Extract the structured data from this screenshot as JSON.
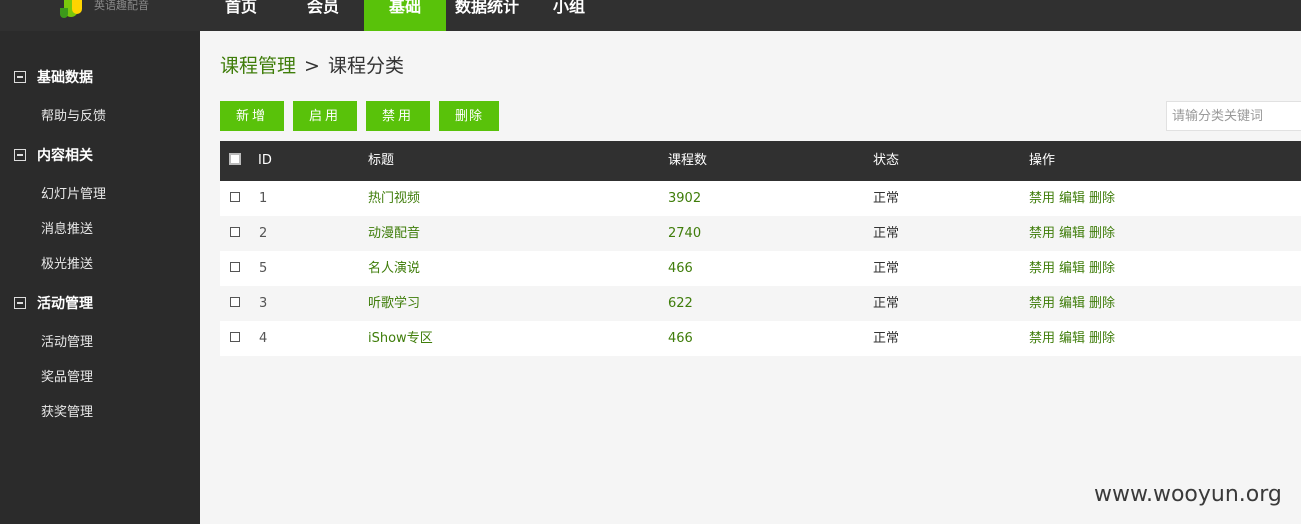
{
  "logo": {
    "text": "英语趣配音"
  },
  "nav": {
    "items": [
      {
        "label": "首页"
      },
      {
        "label": "会员"
      },
      {
        "label": "基础"
      },
      {
        "label": "数据统计"
      },
      {
        "label": "小组"
      }
    ],
    "active_index": 2
  },
  "sidebar": {
    "groups": [
      {
        "label": "基础数据",
        "items": [
          "帮助与反馈"
        ]
      },
      {
        "label": "内容相关",
        "items": [
          "幻灯片管理",
          "消息推送",
          "极光推送"
        ]
      },
      {
        "label": "活动管理",
        "items": [
          "活动管理",
          "奖品管理",
          "获奖管理"
        ]
      }
    ]
  },
  "breadcrumb": {
    "parent": "课程管理",
    "separator": ">",
    "current": "课程分类"
  },
  "toolbar": {
    "add": "新增",
    "enable": "启用",
    "disable": "禁用",
    "delete": "删除"
  },
  "search": {
    "placeholder": "请输分类关键词"
  },
  "table": {
    "headers": {
      "id": "ID",
      "title": "标题",
      "count": "课程数",
      "status": "状态",
      "actions": "操作"
    },
    "rows": [
      {
        "id": "1",
        "title": "热门视频",
        "count": "3902",
        "status": "正常"
      },
      {
        "id": "2",
        "title": "动漫配音",
        "count": "2740",
        "status": "正常"
      },
      {
        "id": "5",
        "title": "名人演说",
        "count": "466",
        "status": "正常"
      },
      {
        "id": "3",
        "title": "听歌学习",
        "count": "622",
        "status": "正常"
      },
      {
        "id": "4",
        "title": "iShow专区",
        "count": "466",
        "status": "正常"
      }
    ],
    "row_actions": {
      "disable": "禁用",
      "edit": "编辑",
      "delete": "删除"
    }
  },
  "watermark": "www.wooyun.org",
  "colors": {
    "accent": "#59c20a",
    "dark": "#303030",
    "sidebar": "#2b2b2b",
    "link": "#3f7d0a"
  }
}
